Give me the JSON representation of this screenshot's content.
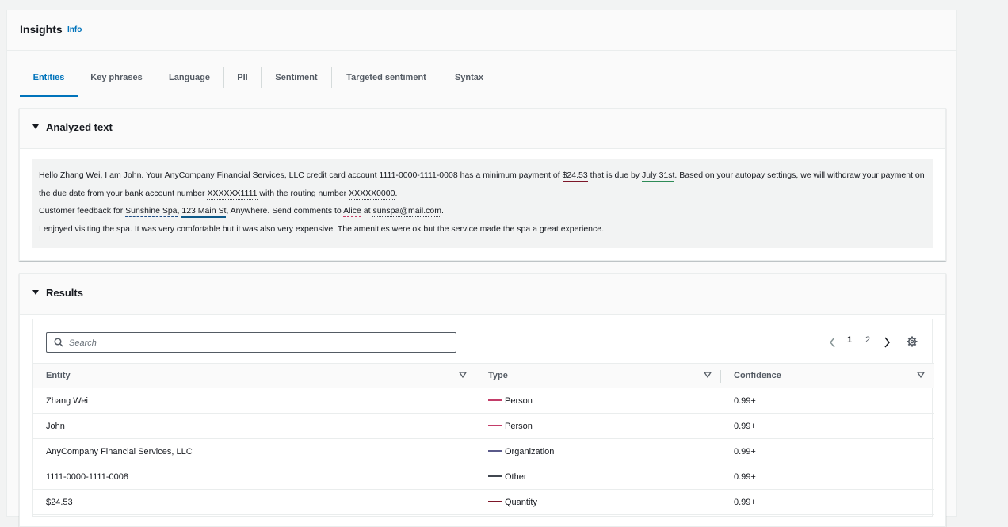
{
  "header": {
    "title": "Insights",
    "info": "Info"
  },
  "tabs": [
    {
      "label": "Entities"
    },
    {
      "label": "Key phrases"
    },
    {
      "label": "Language"
    },
    {
      "label": "PII"
    },
    {
      "label": "Sentiment"
    },
    {
      "label": "Targeted sentiment"
    },
    {
      "label": "Syntax"
    }
  ],
  "analyzed": {
    "title": "Analyzed text",
    "seg": {
      "t0": "Hello ",
      "e0": "Zhang Wei",
      "t1": ", I am ",
      "e1": "John",
      "t2": ". Your ",
      "e2": "AnyCompany Financial Services, LLC",
      "t3": " credit card account ",
      "e3": "1111-0000-1111-0008",
      "t4": " has a minimum payment of ",
      "e4": "$24.53",
      "t5": " that is due by ",
      "e5": "July 31st",
      "t6": ". Based on your autopay settings, we will withdraw your payment on the due date from your bank account number ",
      "e6": "XXXXXX1111",
      "t7": " with the routing number ",
      "e7": "XXXXX0000",
      "t8": ".",
      "t9": "Customer feedback for ",
      "e8": "Sunshine Spa",
      "t10": ", ",
      "e9": "123 Main St",
      "t11": ", Anywhere. Send comments to ",
      "e10": "Alice",
      "t12": " at ",
      "e11": "sunspa@mail.com",
      "t13": ".",
      "t14": "I enjoyed visiting the spa. It was very comfortable but it was also very expensive. The amenities were ok but the service made the spa a great experience."
    }
  },
  "results": {
    "title": "Results",
    "search_placeholder": "Search",
    "pages": [
      "1",
      "2"
    ],
    "columns": {
      "entity": "Entity",
      "type": "Type",
      "confidence": "Confidence"
    },
    "rows": [
      {
        "entity": "Zhang Wei",
        "type": "Person",
        "confidence": "0.99+",
        "color": "#c33d69"
      },
      {
        "entity": "John",
        "type": "Person",
        "confidence": "0.99+",
        "color": "#c33d69"
      },
      {
        "entity": "AnyCompany Financial Services, LLC",
        "type": "Organization",
        "confidence": "0.99+",
        "color": "#5a5a8a"
      },
      {
        "entity": "1111-0000-1111-0008",
        "type": "Other",
        "confidence": "0.99+",
        "color": "#414750"
      },
      {
        "entity": "$24.53",
        "type": "Quantity",
        "confidence": "0.99+",
        "color": "#7d1628"
      }
    ]
  },
  "colors": {
    "accent": "#0073bb"
  },
  "icons": {
    "search": "search-icon",
    "settings": "gear-icon",
    "prev": "chevron-left-icon",
    "next": "chevron-right-icon",
    "sort": "sort-down-icon"
  }
}
